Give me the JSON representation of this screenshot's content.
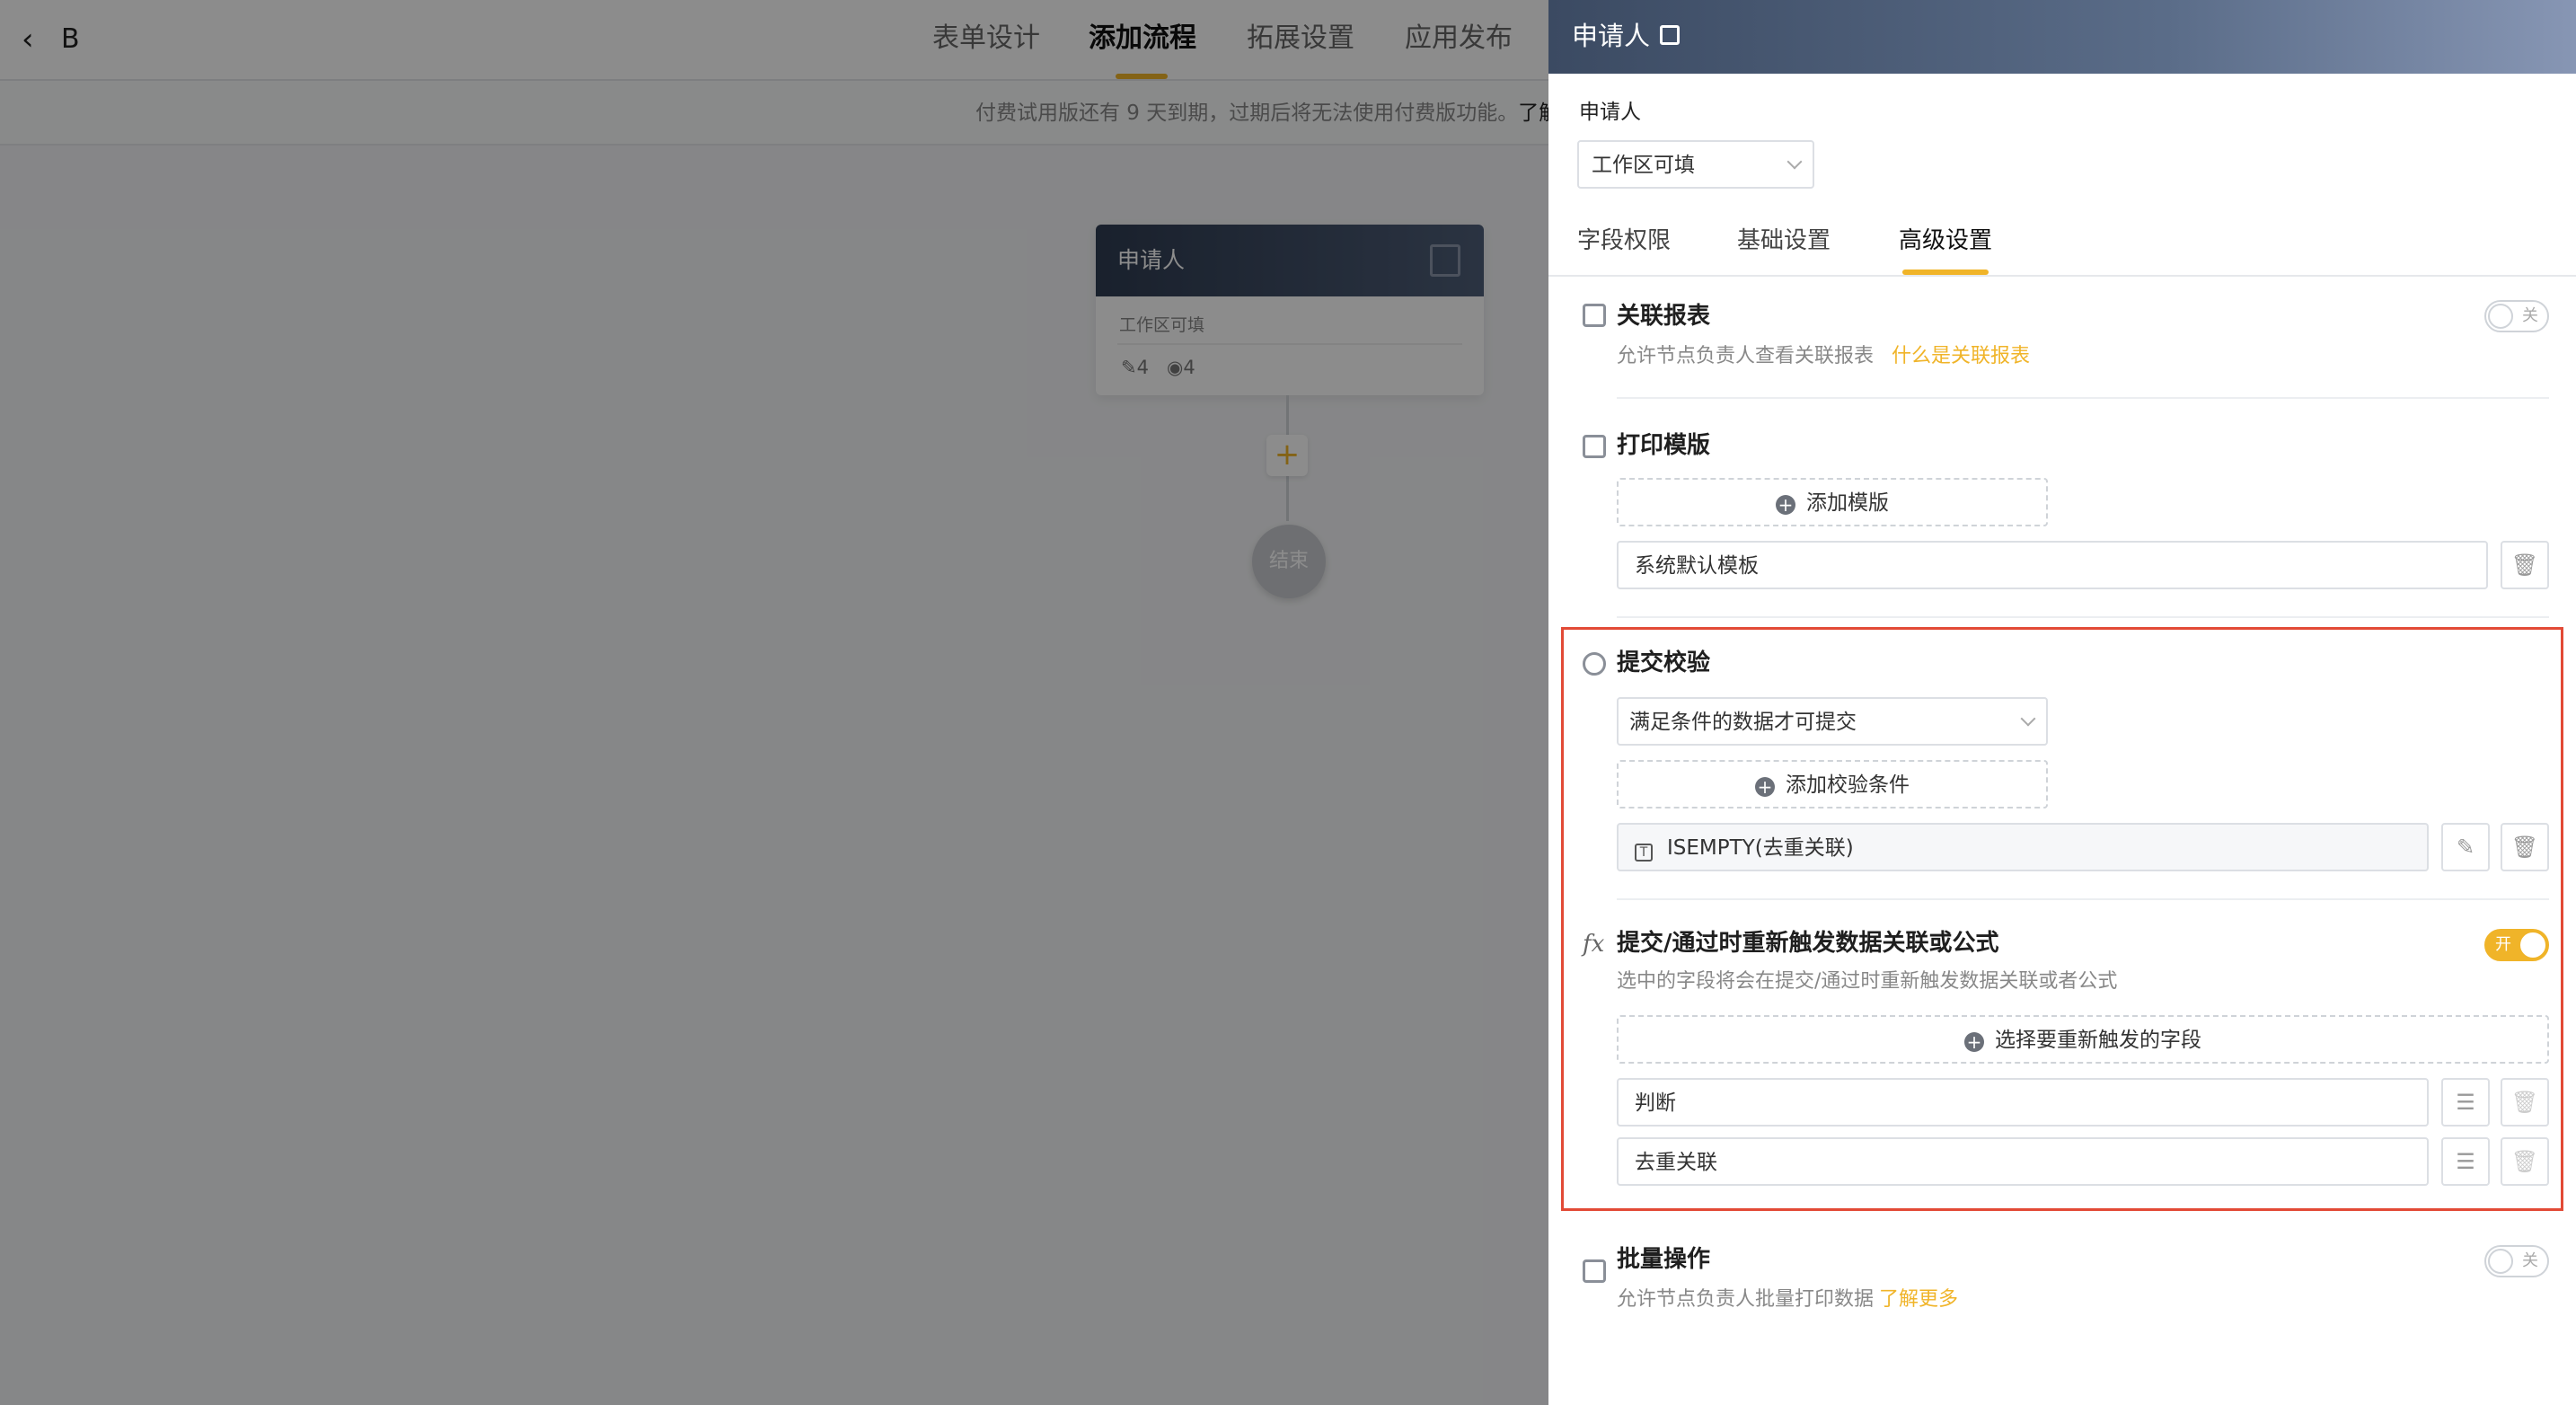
{
  "topbar": {
    "back_icon": "chevron-left-icon",
    "app_name": "B",
    "tabs": [
      {
        "label": "表单设计",
        "active": false
      },
      {
        "label": "添加流程",
        "active": true
      },
      {
        "label": "拓展设置",
        "active": false
      },
      {
        "label": "应用发布",
        "active": false
      }
    ]
  },
  "trial_notice": {
    "text": "付费试用版还有 9 天到期，过期后将无法使用付费版功能。",
    "link": "了解"
  },
  "flow": {
    "node": {
      "title": "申请人",
      "subtitle": "工作区可填",
      "edit_count": "4",
      "view_count": "4"
    },
    "add_symbol": "+",
    "end_label": "结束"
  },
  "drawer": {
    "title": "申请人",
    "field_label": "申请人",
    "select_value": "工作区可填",
    "tabs": [
      {
        "label": "字段权限",
        "active": false
      },
      {
        "label": "基础设置",
        "active": false
      },
      {
        "label": "高级设置",
        "active": true
      }
    ],
    "sections": {
      "related_report": {
        "title": "关联报表",
        "desc": "允许节点负责人查看关联报表",
        "link": "什么是关联报表",
        "toggle_label": "关",
        "enabled": false
      },
      "print_template": {
        "title": "打印模版",
        "add_button": "添加模版",
        "templates": [
          "系统默认模板"
        ]
      },
      "submit_check": {
        "title": "提交校验",
        "select_value": "满足条件的数据才可提交",
        "add_button": "添加校验条件",
        "conditions": [
          "ISEMPTY(去重关联)"
        ]
      },
      "retrigger": {
        "title": "提交/通过时重新触发数据关联或公式",
        "desc": "选中的字段将会在提交/通过时重新触发数据关联或者公式",
        "toggle_label": "开",
        "enabled": true,
        "add_button": "选择要重新触发的字段",
        "fields": [
          "判断",
          "去重关联"
        ]
      },
      "batch": {
        "title": "批量操作",
        "desc": "允许节点负责人批量打印数据",
        "link": "了解更多",
        "toggle_label": "关",
        "enabled": false
      }
    }
  },
  "colors": {
    "accent": "#f0b429",
    "header_dark": "#3b4a62",
    "highlight": "#e24a36"
  }
}
